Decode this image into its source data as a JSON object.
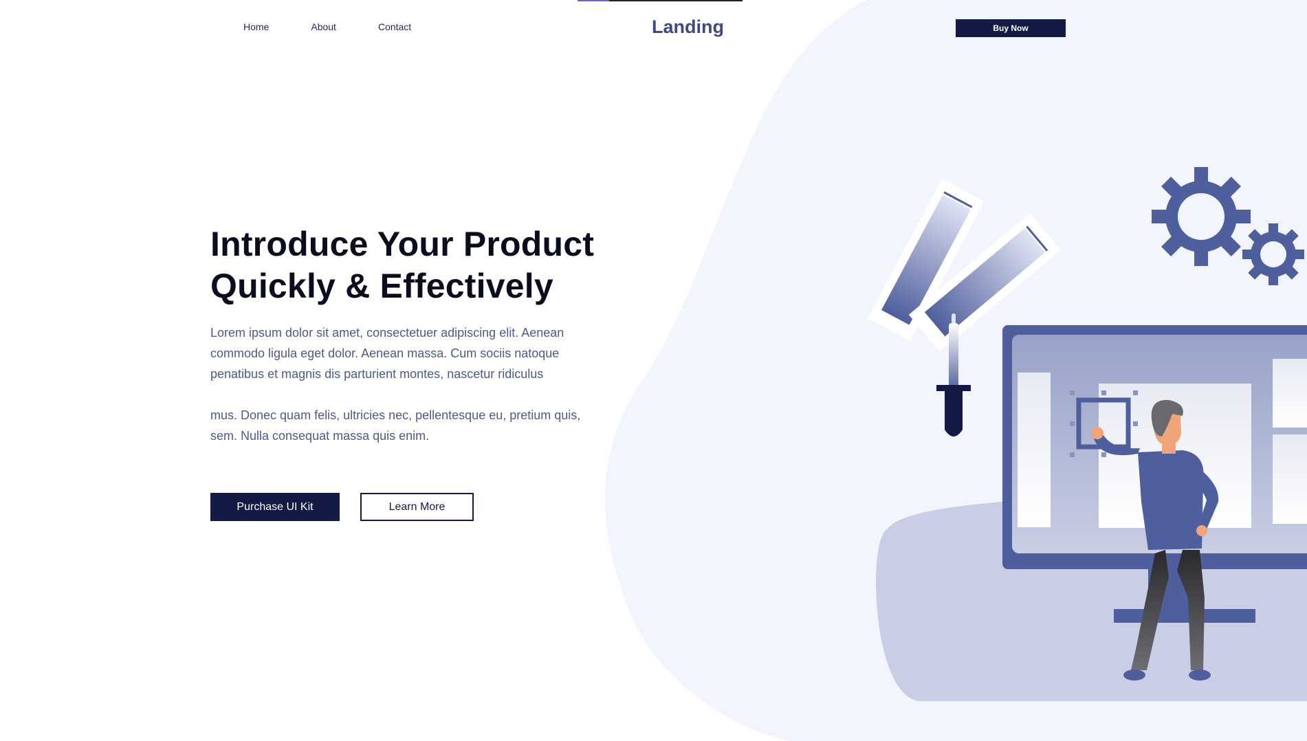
{
  "nav": {
    "links": [
      "Home",
      "About",
      "Contact"
    ],
    "logo": "Landing",
    "cta": "Buy Now"
  },
  "hero": {
    "title_line1": "Introduce Your Product",
    "title_line2": "Quickly & Effectively",
    "paragraph1": "Lorem ipsum dolor sit amet, consectetuer adipiscing elit. Aenean commodo ligula eget dolor. Aenean massa. Cum sociis natoque penatibus et magnis dis parturient montes, nascetur ridiculus",
    "paragraph2": "mus. Donec quam felis, ultricies nec, pellentesque eu, pretium quis, sem. Nulla consequat massa quis enim.",
    "primary_button": "Purchase UI Kit",
    "secondary_button": "Learn More"
  },
  "colors": {
    "accent_dark": "#121a45",
    "logo": "#3c4a7f",
    "body_text": "#4e5a8a",
    "illustration_primary": "#4f5e9c",
    "background_blob": "#f2f5fd"
  },
  "illustration": {
    "icons": [
      "gear-icon",
      "gear-icon",
      "color-swatch-icon",
      "dropper-icon",
      "monitor-icon",
      "person-icon"
    ]
  }
}
